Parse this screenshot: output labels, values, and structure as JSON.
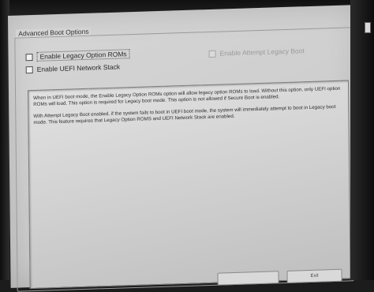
{
  "group": {
    "title": "Advanced Boot Options"
  },
  "options": [
    {
      "label": "Enable Legacy Option ROMs",
      "checked": false,
      "focused": true,
      "enabled": true
    },
    {
      "label": "Enable UEFI Network Stack",
      "checked": false,
      "focused": false,
      "enabled": true
    },
    {
      "label": "Enable Attempt Legacy Boot",
      "checked": false,
      "focused": false,
      "enabled": false
    }
  ],
  "description": {
    "paragraph1": "When in UEFI boot mode, the Enable Legacy Option ROMs option will allow legacy option ROMs to load. Without this option, only UEFI option ROMs will load. This option is required for Legacy boot mode. This option is not allowed if Secure Boot is enabled.",
    "paragraph2": "With Attempt Legacy Boot enabled, if the system fails to boot in UEFI boot mode, the system will immediately attempt to boot in Legacy boot mode. This feature requires that Legacy Option ROMS and UEFI Network Stack are enabled."
  },
  "buttons": {
    "exit_label": "Exit"
  }
}
